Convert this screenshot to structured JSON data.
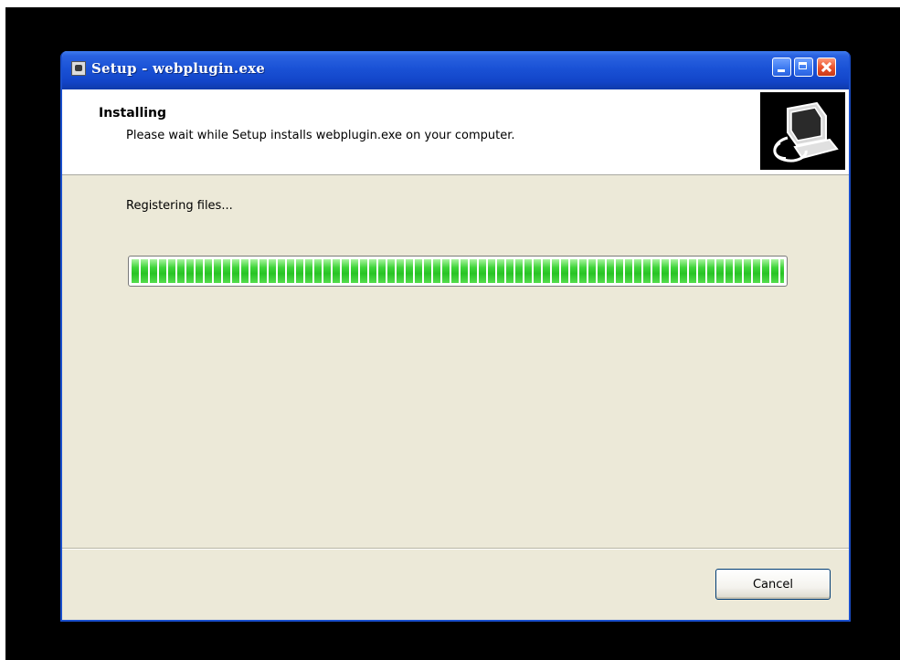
{
  "window": {
    "title": "Setup - webplugin.exe"
  },
  "header": {
    "title": "Installing",
    "subtitle": "Please wait while Setup installs webplugin.exe on your computer.",
    "image_icon": "computer-install-icon"
  },
  "main": {
    "status_text": "Registering files...",
    "progress": 1.0
  },
  "footer": {
    "cancel_label": "Cancel"
  },
  "colors": {
    "titlebar": "#1a52d6",
    "progress_fill": "#3fd43a",
    "window_bg": "#ece9d8"
  }
}
